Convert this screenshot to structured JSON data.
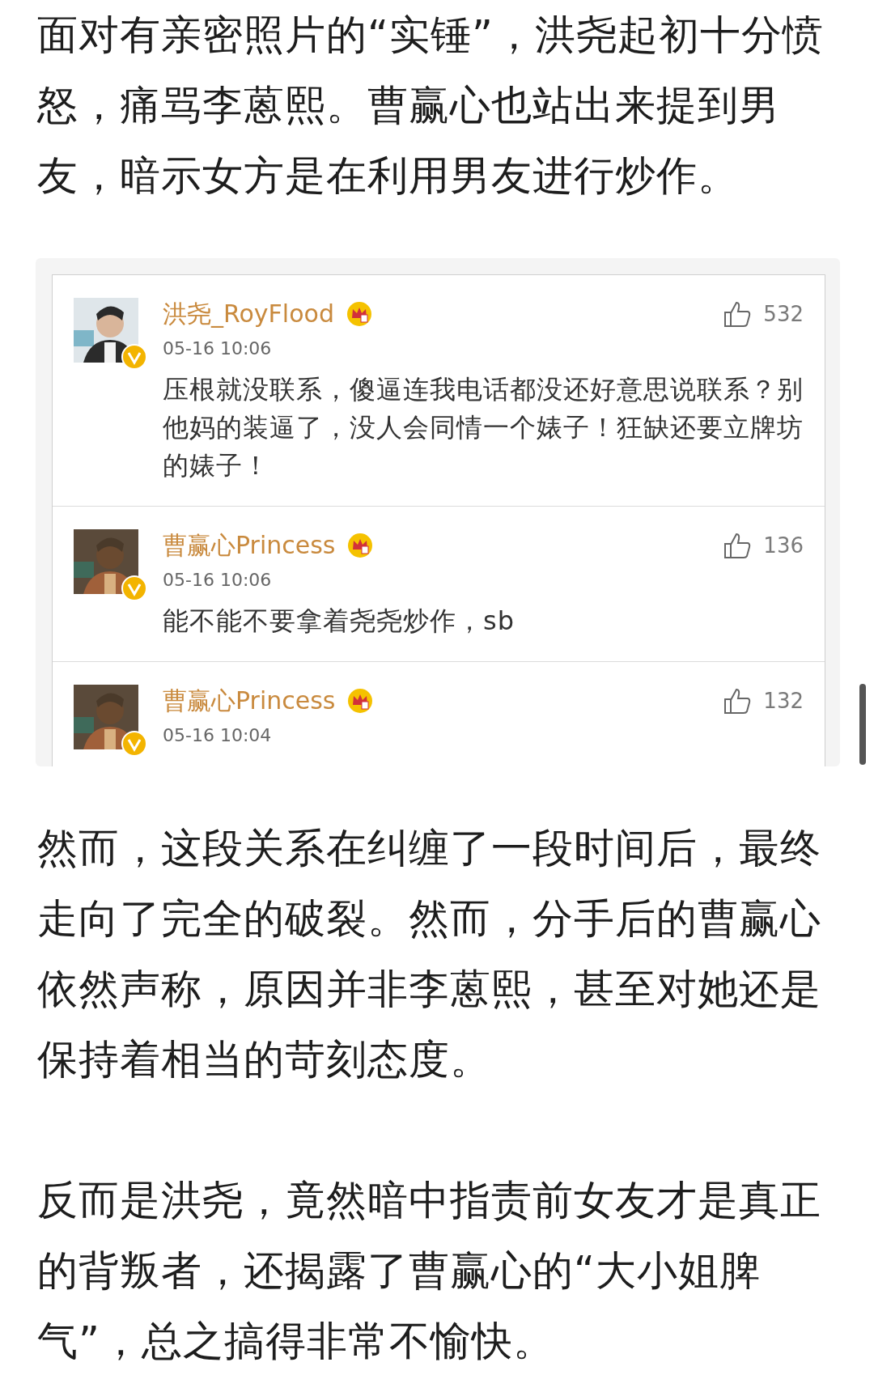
{
  "paragraphs_before": [
    "面对有亲密照片的“实锤”，洪尧起初十分愤怒，痛骂李蒽熙。曹赢心也站出来提到男友，暗示女方是在利用男友进行炒作。"
  ],
  "comments": [
    {
      "user": "洪尧_RoyFlood",
      "time": "05-16 10:06",
      "likes": "532",
      "text": "压根就没联系，傻逼连我电话都没还好意思说联系？别他妈的装逼了，没人会同情一个婊子！狂缺还要立牌坊的婊子！"
    },
    {
      "user": "曹赢心Princess",
      "time": "05-16 10:06",
      "likes": "136",
      "text": "能不能不要拿着尧尧炒作，sb"
    },
    {
      "user": "曹赢心Princess",
      "time": "05-16 10:04",
      "likes": "132"
    }
  ],
  "paragraphs_after": [
    "然而，这段关系在纠缠了一段时间后，最终走向了完全的破裂。然而，分手后的曹赢心依然声称，原因并非李蒽熙，甚至对她还是保持着相当的苛刻态度。",
    "反而是洪尧，竟然暗中指责前女友才是真正的背叛者，还揭露了曹赢心的“大小姐脾气”，总之搞得非常不愉快。"
  ]
}
